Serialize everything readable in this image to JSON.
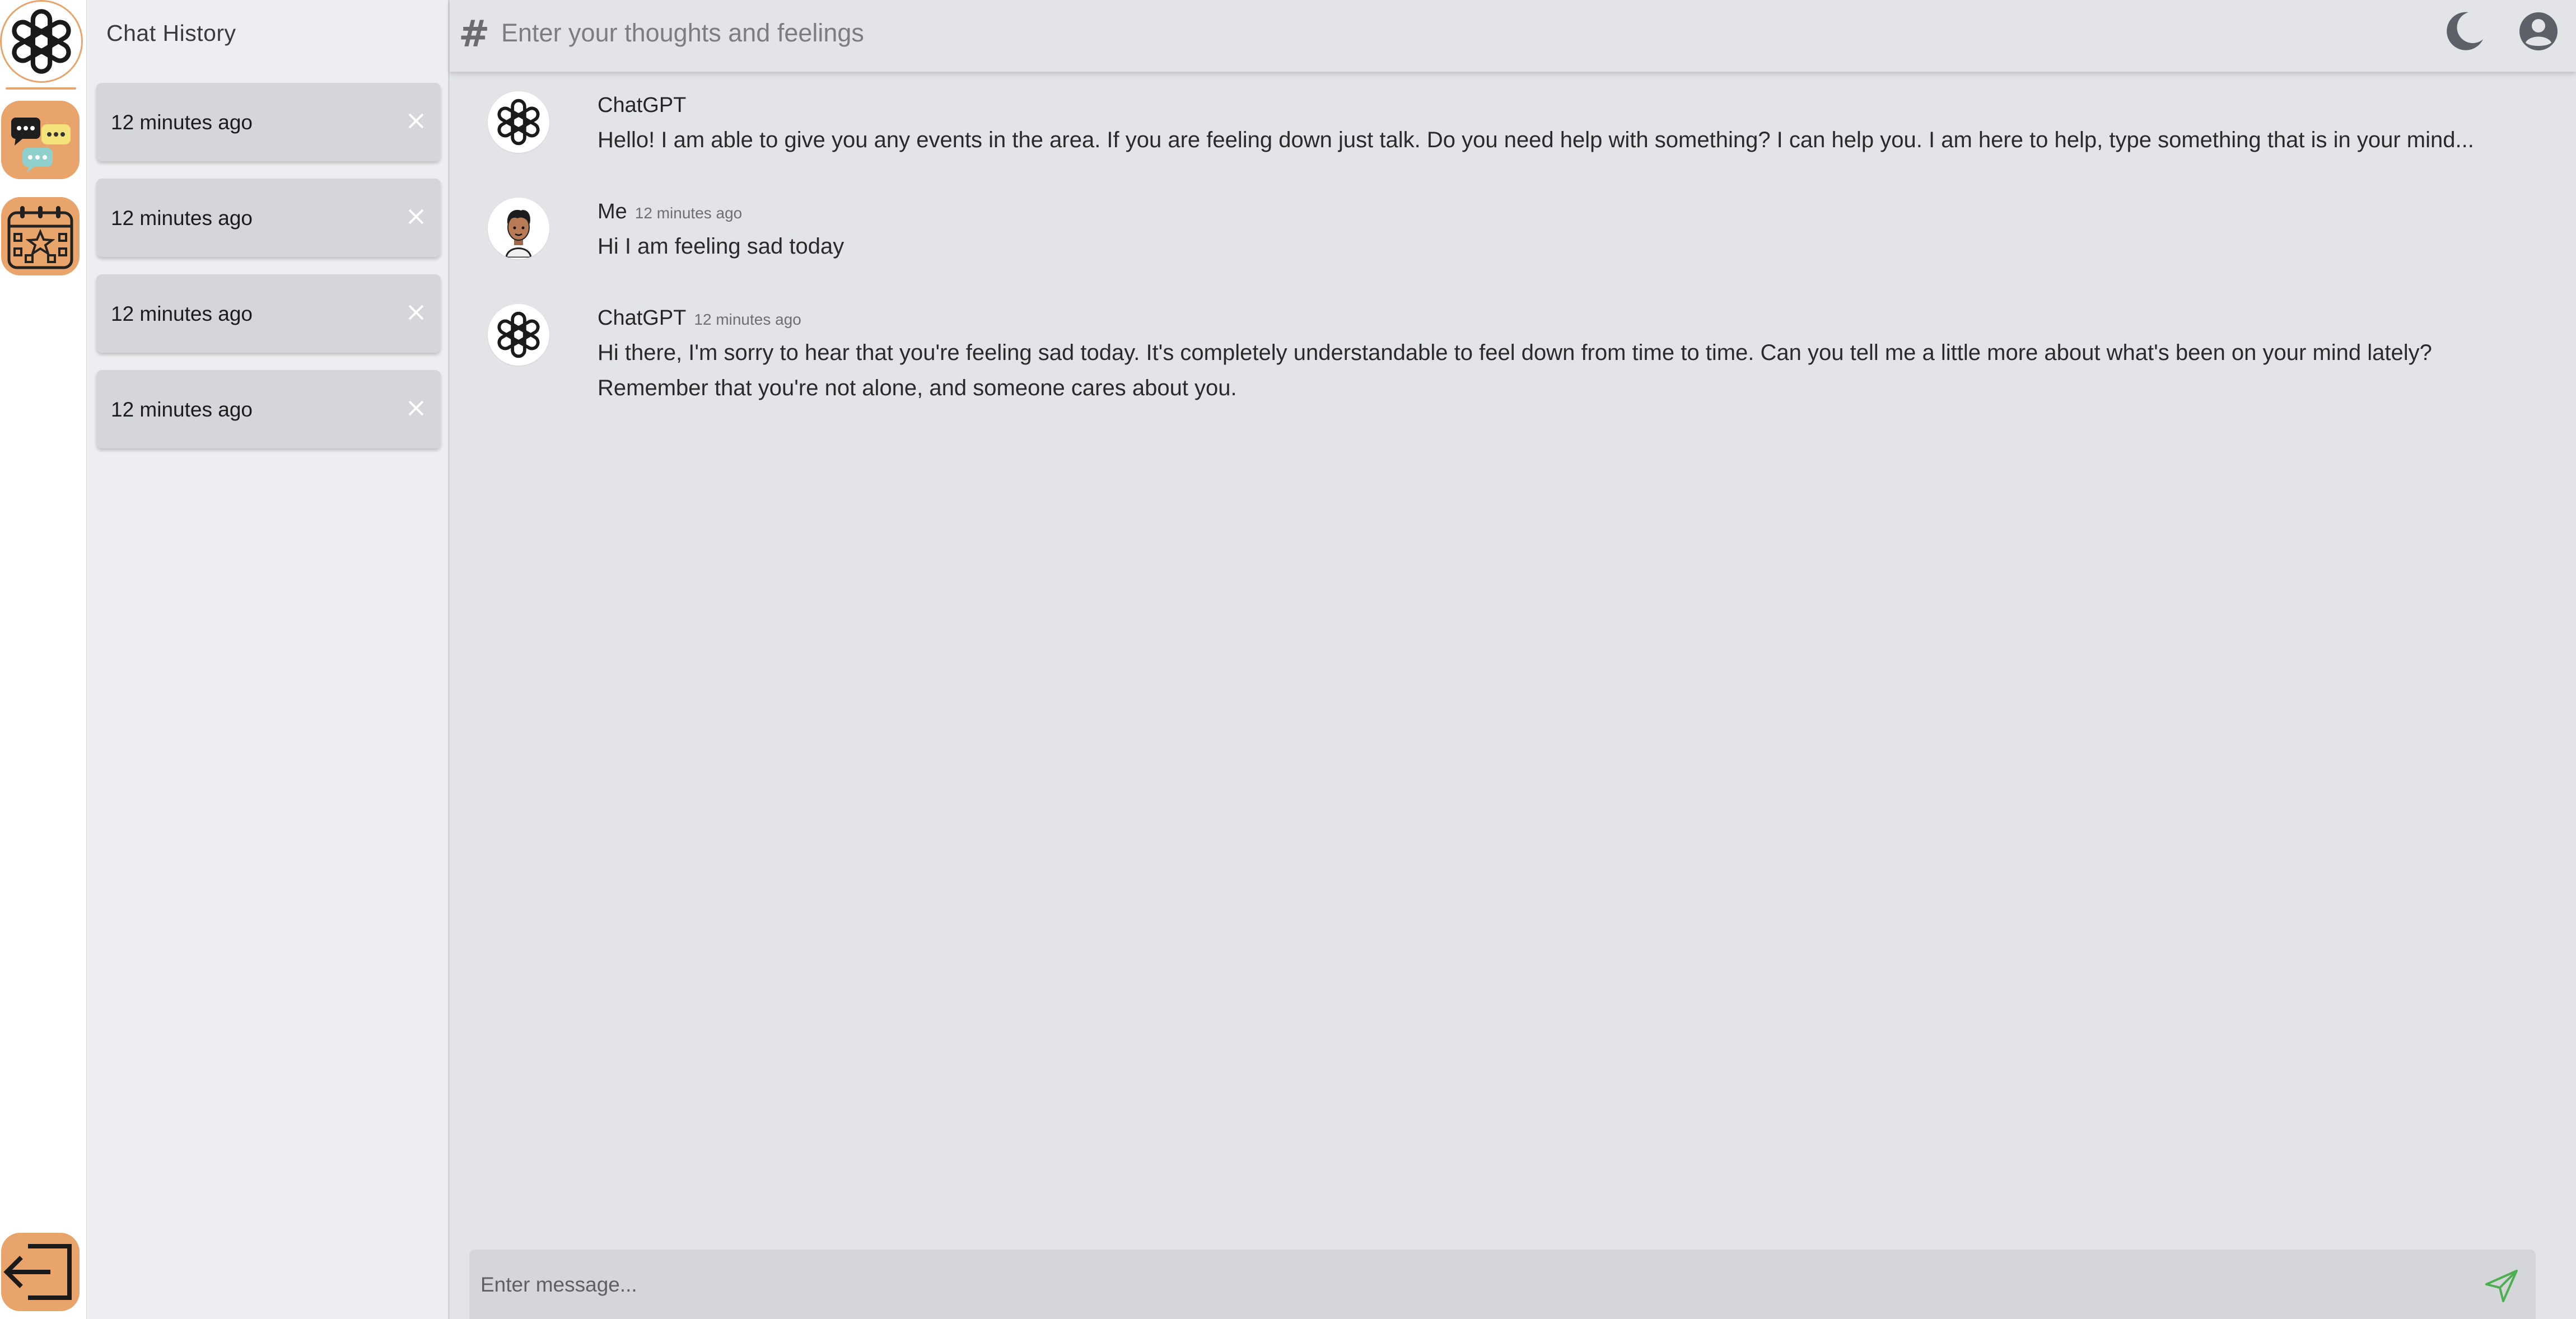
{
  "rail": {
    "items": [
      {
        "name": "openai-logo-icon"
      },
      {
        "name": "chat-bubbles-icon"
      },
      {
        "name": "calendar-icon"
      },
      {
        "name": "logout-icon"
      }
    ],
    "accent": "#e9a46c"
  },
  "history": {
    "title": "Chat History",
    "items": [
      {
        "label": "12 minutes ago"
      },
      {
        "label": "12 minutes ago"
      },
      {
        "label": "12 minutes ago"
      },
      {
        "label": "12 minutes ago"
      }
    ]
  },
  "topbar": {
    "hash": "#",
    "topic_placeholder": "Enter your thoughts and feelings",
    "icons": [
      "moon-icon",
      "user-account-icon"
    ]
  },
  "messages": [
    {
      "author": "ChatGPT",
      "time": "",
      "text": "Hello! I am able to give you any events in the area. If you are feeling down just talk. Do you need help with something? I can help you. I am here to help, type something that is in your mind..."
    },
    {
      "author": "Me",
      "time": "12 minutes ago",
      "text": "Hi I am feeling sad today"
    },
    {
      "author": "ChatGPT",
      "time": "12 minutes ago",
      "text": "Hi there, I'm sorry to hear that you're feeling sad today. It's completely understandable to feel down from time to time. Can you tell me a little more about what's been on your mind lately? Remember that you're not alone, and someone cares about you."
    }
  ],
  "composer": {
    "placeholder": "Enter message...",
    "send_color": "#4caf50"
  }
}
